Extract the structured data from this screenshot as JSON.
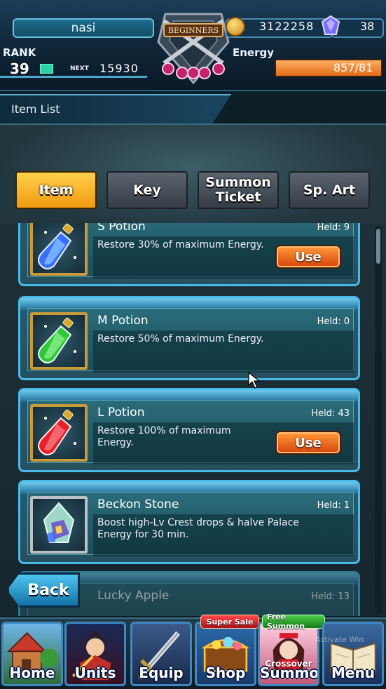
{
  "hud": {
    "player_name": "nasi",
    "rank_label": "RANK",
    "rank_value": "39",
    "next_label": "NEXT",
    "next_exp": "15930",
    "emblem_label": "BEGINNERS",
    "coins": "3122258",
    "gems": "38",
    "energy_label": "Energy",
    "energy_value": "857/81"
  },
  "header": {
    "title": "Item List"
  },
  "tabs": [
    {
      "label": "Item",
      "active": true
    },
    {
      "label": "Key",
      "active": false
    },
    {
      "label": "Summon Ticket",
      "active": false
    },
    {
      "label": "Sp. Art",
      "active": false
    }
  ],
  "items": [
    {
      "name": "S Potion",
      "held": "Held: 9",
      "description": "Restore 30% of maximum Energy.",
      "use_label": "Use",
      "potion_color": "#3a70ff"
    },
    {
      "name": "M Potion",
      "held": "Held: 0",
      "description": "Restore 50% of maximum Energy.",
      "use_label": "",
      "potion_color": "#2ec83a"
    },
    {
      "name": "L Potion",
      "held": "Held: 43",
      "description": "Restore 100% of maximum Energy.",
      "use_label": "Use",
      "potion_color": "#e8202a"
    },
    {
      "name": "Beckon Stone",
      "held": "Held: 1",
      "description": "Boost high-Lv Crest drops & halve Palace Energy for 30 min.",
      "use_label": ""
    },
    {
      "name": "Lucky Apple",
      "held": "Held: 13"
    }
  ],
  "back_button": "Back",
  "nav": {
    "home": "Home",
    "units": "Units",
    "equip": "Equip",
    "shop": "Shop",
    "shop_badge": "Super Sale",
    "summon": "Summon",
    "summon_badge": "Free Summon",
    "summon_subtitle": "Crossover",
    "menu": "Menu"
  },
  "watermark": "Activate Win",
  "colors": {
    "accent": "#4ab9e8",
    "active_tab": "#f09a10",
    "use_button": "#d8440c"
  }
}
